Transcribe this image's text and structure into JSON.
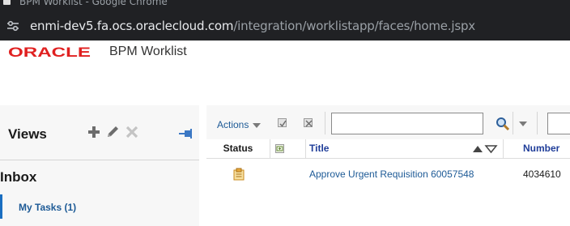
{
  "browser": {
    "window_title": "BPM Worklist - Google Chrome",
    "url_host": "enmi-dev5.fa.ocs.oraclecloud.com",
    "url_path": "/integration/worklistapp/faces/home.jspx"
  },
  "header": {
    "logo_text": "ORACLE",
    "logo_color": "#e02020",
    "app_title": "BPM Worklist"
  },
  "left_panel": {
    "views_title": "Views",
    "inbox_title": "Inbox",
    "my_tasks_label": "My Tasks (1)",
    "icons": [
      "plus-icon",
      "pencil-icon",
      "close-icon",
      "pin-icon"
    ]
  },
  "toolbar": {
    "actions_label": "Actions",
    "search_value": "",
    "icons": [
      "checkbox-icon",
      "close-box-icon",
      "search-icon",
      "chevron-down-icon"
    ]
  },
  "table": {
    "columns": [
      "Status",
      "",
      "Title",
      "Number"
    ],
    "rows": [
      {
        "status_icon": "clipboard-icon",
        "title": "Approve Urgent Requisition 60057548",
        "number": "4034610"
      }
    ]
  },
  "colors": {
    "accent_link": "#1d5a96",
    "header_link": "#1f3d99",
    "selection_bar": "#1a6ec1",
    "browser_chrome": "#202124"
  }
}
